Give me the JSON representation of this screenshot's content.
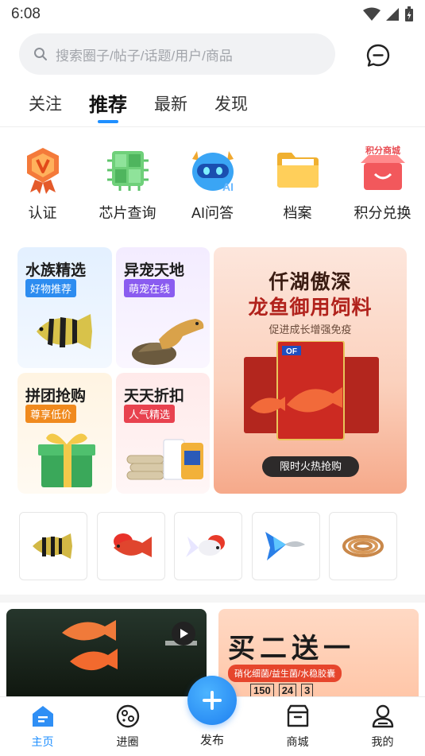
{
  "status_bar": {
    "time": "6:08"
  },
  "search": {
    "placeholder": "搜索圈子/帖子/话题/用户/商品"
  },
  "tabs": [
    {
      "label": "关注"
    },
    {
      "label": "推荐",
      "active": true
    },
    {
      "label": "最新"
    },
    {
      "label": "发现"
    }
  ],
  "quick_entries": [
    {
      "label": "认证",
      "icon": "v-badge-icon"
    },
    {
      "label": "芯片查询",
      "icon": "chip-icon"
    },
    {
      "label": "AI问答",
      "icon": "ai-robot-icon"
    },
    {
      "label": "档案",
      "icon": "folder-icon"
    },
    {
      "label": "积分兑换",
      "icon": "points-shop-icon",
      "icon_text": "积分商城"
    }
  ],
  "promo_cards": [
    {
      "title": "水族精选",
      "tag": "好物推荐",
      "tag_color": "#2d8cf0"
    },
    {
      "title": "异宠天地",
      "tag": "萌宠在线",
      "tag_color": "#8a5cf0"
    },
    {
      "title": "拼团抢购",
      "tag": "尊享低价",
      "tag_color": "#f08a1e"
    },
    {
      "title": "天天折扣",
      "tag": "人气精选",
      "tag_color": "#e8424f"
    }
  ],
  "banner": {
    "line1": "仟湖傲深",
    "line2": "龙鱼御用饲料",
    "subtitle": "促进成长增强免疫",
    "cta": "限时火热抢购",
    "bag_brand": "OF"
  },
  "thumbnails": [
    {
      "icon": "tiger-fish-icon"
    },
    {
      "icon": "flowerhorn-fish-icon"
    },
    {
      "icon": "goldfish-icon"
    },
    {
      "icon": "guppy-fish-icon"
    },
    {
      "icon": "bloodworm-food-icon"
    }
  ],
  "feed": {
    "promo_title": "买二送一",
    "promo_tag": "硝化细菌/益生菌/水稳胶囊",
    "promo_numbers": [
      "150",
      "24",
      "3"
    ]
  },
  "bottom_nav": [
    {
      "label": "主页",
      "active": true
    },
    {
      "label": "进圈"
    },
    {
      "label": "发布"
    },
    {
      "label": "商城"
    },
    {
      "label": "我的"
    }
  ],
  "colors": {
    "accent": "#1f8fff",
    "banner_red": "#b1221c"
  }
}
